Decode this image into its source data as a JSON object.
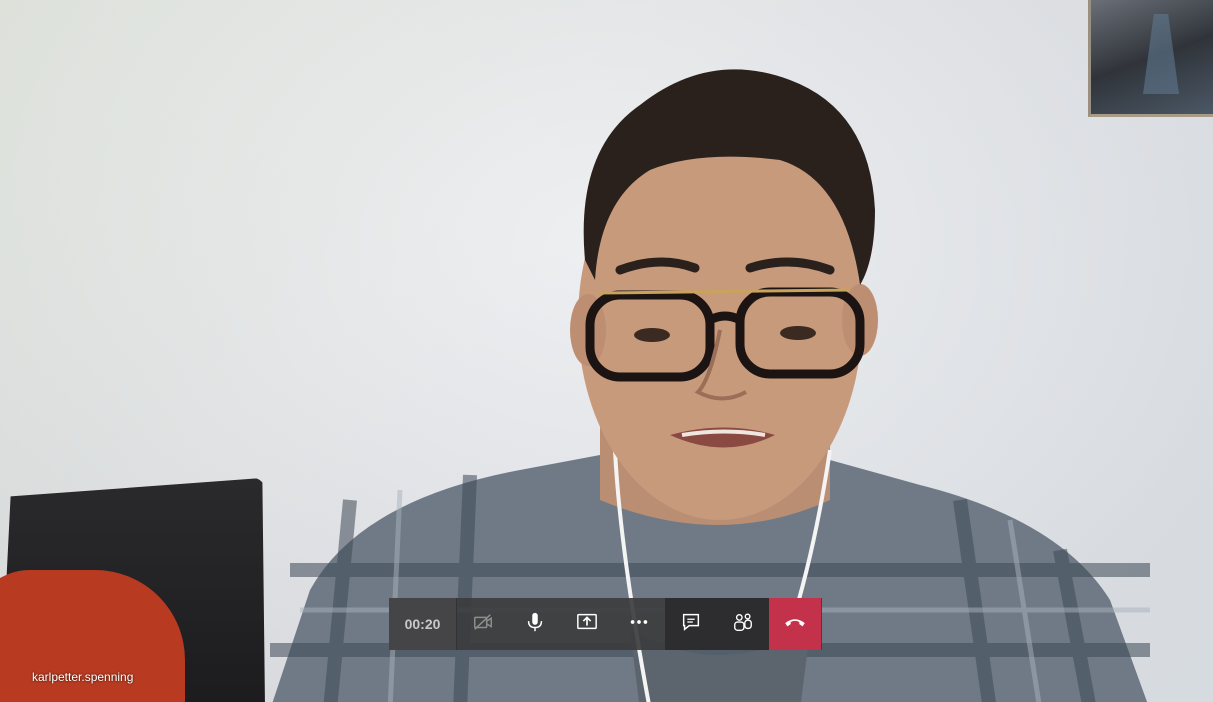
{
  "meeting": {
    "participant_name": "karlpetter.spenning",
    "elapsed_time": "00:20"
  },
  "controls": [
    {
      "name": "camera-off-button",
      "icon": "camera-off-icon"
    },
    {
      "name": "microphone-button",
      "icon": "microphone-icon"
    },
    {
      "name": "share-screen-button",
      "icon": "share-screen-icon"
    },
    {
      "name": "more-actions-button",
      "icon": "more-icon"
    },
    {
      "name": "chat-button",
      "icon": "chat-icon"
    },
    {
      "name": "participants-button",
      "icon": "participants-icon"
    },
    {
      "name": "hang-up-button",
      "icon": "hang-up-icon"
    }
  ],
  "colors": {
    "hangup": "#c4314b",
    "bar": "#3c3c3e",
    "icon": "#ffffff"
  }
}
